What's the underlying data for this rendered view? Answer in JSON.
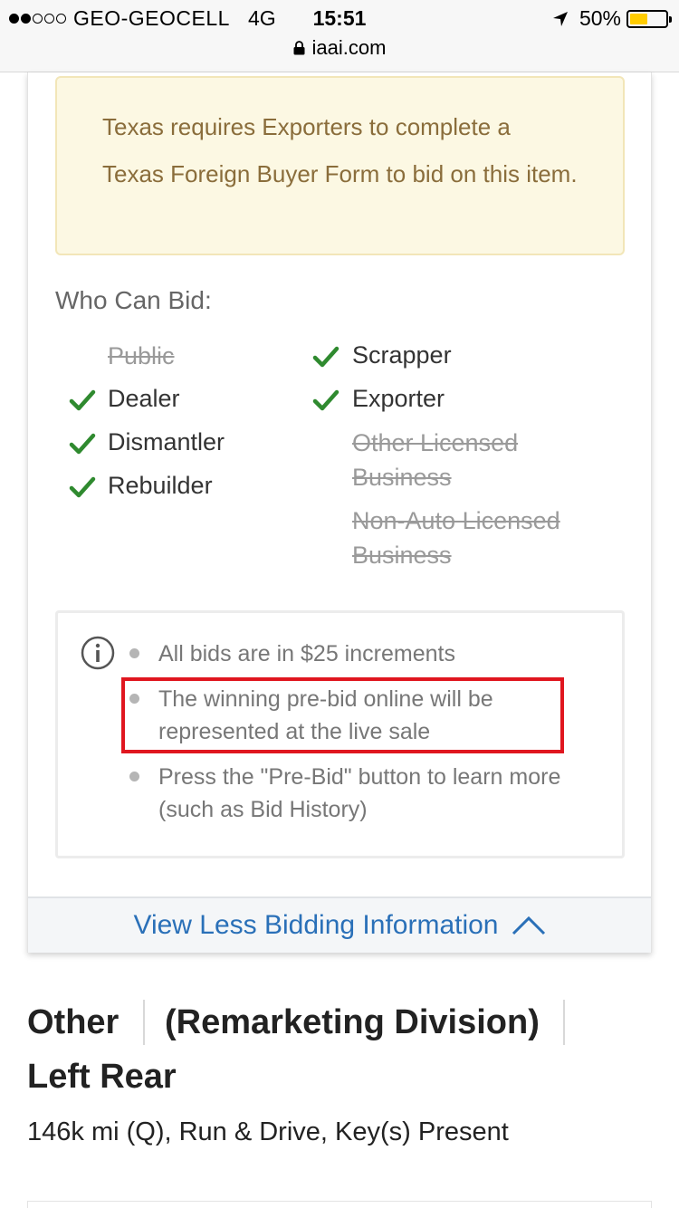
{
  "status_bar": {
    "carrier": "GEO-GEOCELL",
    "network": "4G",
    "time": "15:51",
    "battery": "50%",
    "url": "iaai.com",
    "battery_color": "#ffcc00"
  },
  "notice": {
    "text": "Texas requires Exporters to complete a Texas Foreign Buyer Form to bid on this item."
  },
  "who_can_bid": {
    "label": "Who Can Bid:",
    "left_column": [
      {
        "label": "Public",
        "allowed": false
      },
      {
        "label": "Dealer",
        "allowed": true
      },
      {
        "label": "Dismantler",
        "allowed": true
      },
      {
        "label": "Rebuilder",
        "allowed": true
      }
    ],
    "right_column": [
      {
        "label": "Scrapper",
        "allowed": true
      },
      {
        "label": "Exporter",
        "allowed": true
      },
      {
        "label": "Other Licensed Business",
        "allowed": false
      },
      {
        "label": "Non-Auto Licensed Business",
        "allowed": false
      }
    ],
    "check_color": "#2f8a2f"
  },
  "bid_info": {
    "icon": "info-icon",
    "bullets": [
      "All bids are in $25 increments",
      "The winning pre-bid online will be represented at the live sale",
      "Press the \"Pre-Bid\" button to learn more (such as Bid History)"
    ],
    "highlight_color": "#e0161f"
  },
  "toggle": {
    "label": "View Less Bidding Information",
    "icon": "chevron-up-icon",
    "color": "#2a70b8"
  },
  "vehicle": {
    "title_parts": [
      "Other",
      "(Remarketing Division)",
      "Left Rear"
    ],
    "summary": "146k mi (Q), Run & Drive, Key(s) Present"
  }
}
